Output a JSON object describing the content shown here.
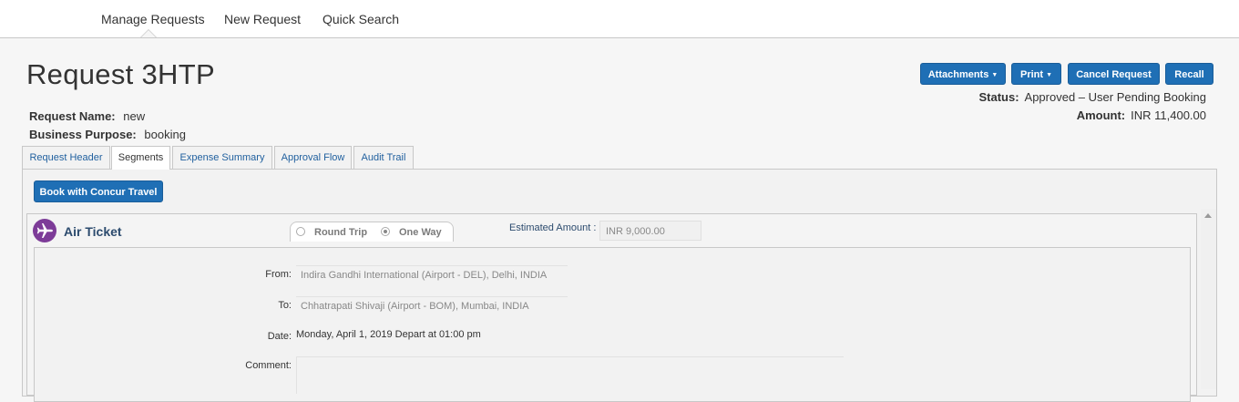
{
  "nav": {
    "items": [
      "Manage Requests",
      "New Request",
      "Quick Search"
    ]
  },
  "request": {
    "title": "Request 3HTP",
    "name_label": "Request Name:",
    "name_value": "new",
    "purpose_label": "Business Purpose:",
    "purpose_value": "booking"
  },
  "actions": {
    "attachments": "Attachments",
    "print": "Print",
    "cancel": "Cancel Request",
    "recall": "Recall"
  },
  "status": {
    "status_label": "Status:",
    "status_value": "Approved – User Pending Booking",
    "amount_label": "Amount:",
    "amount_value": "INR 11,400.00"
  },
  "tabs": [
    "Request Header",
    "Segments",
    "Expense Summary",
    "Approval Flow",
    "Audit Trail"
  ],
  "book_button": "Book with Concur Travel",
  "segment": {
    "icon": "airplane-icon",
    "accent": "#7d3c98",
    "title": "Air Ticket",
    "round_trip": "Round Trip",
    "one_way": "One Way",
    "selected_trip": "One Way",
    "estimated_label": "Estimated Amount :",
    "estimated_value": "INR 9,000.00",
    "from_label": "From:",
    "from_value": "Indira Gandhi International (Airport - DEL), Delhi, INDIA",
    "to_label": "To:",
    "to_value": "Chhatrapati Shivaji (Airport - BOM), Mumbai, INDIA",
    "date_label": "Date:",
    "date_value": "Monday, April 1, 2019 Depart at 01:00 pm",
    "comment_label": "Comment:",
    "comment_value": ""
  }
}
